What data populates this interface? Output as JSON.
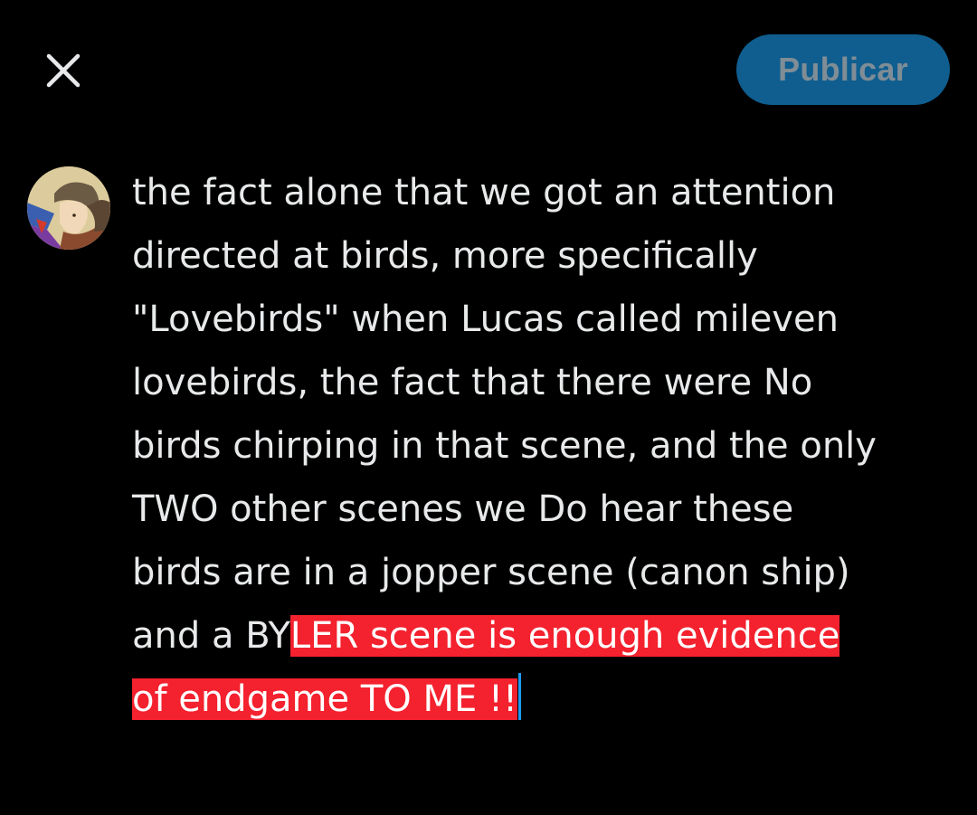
{
  "header": {
    "publish_label": "Publicar"
  },
  "post": {
    "lines": [
      "the fact alone that we got an attention",
      "directed at birds, more specifically",
      "\"Lovebirds\" when Lucas called mileven",
      "lovebirds, the fact that there were No",
      "birds chirping in that scene, and the only",
      "TWO other scenes we Do hear these",
      "birds are in a jopper scene (canon ship)"
    ],
    "line8_plain": "and a BY",
    "line8_selected": "LER scene is enough evidence",
    "line9_selected": "of endgame TO ME !!"
  },
  "icons": {
    "close": "close-icon",
    "avatar": "avatar-image"
  },
  "colors": {
    "background": "#000000",
    "text": "#e7e9ea",
    "publish_bg": "#0f5e8f",
    "publish_text": "#7f8d96",
    "selection": "#f4212e",
    "caret": "#1d9bf0"
  }
}
